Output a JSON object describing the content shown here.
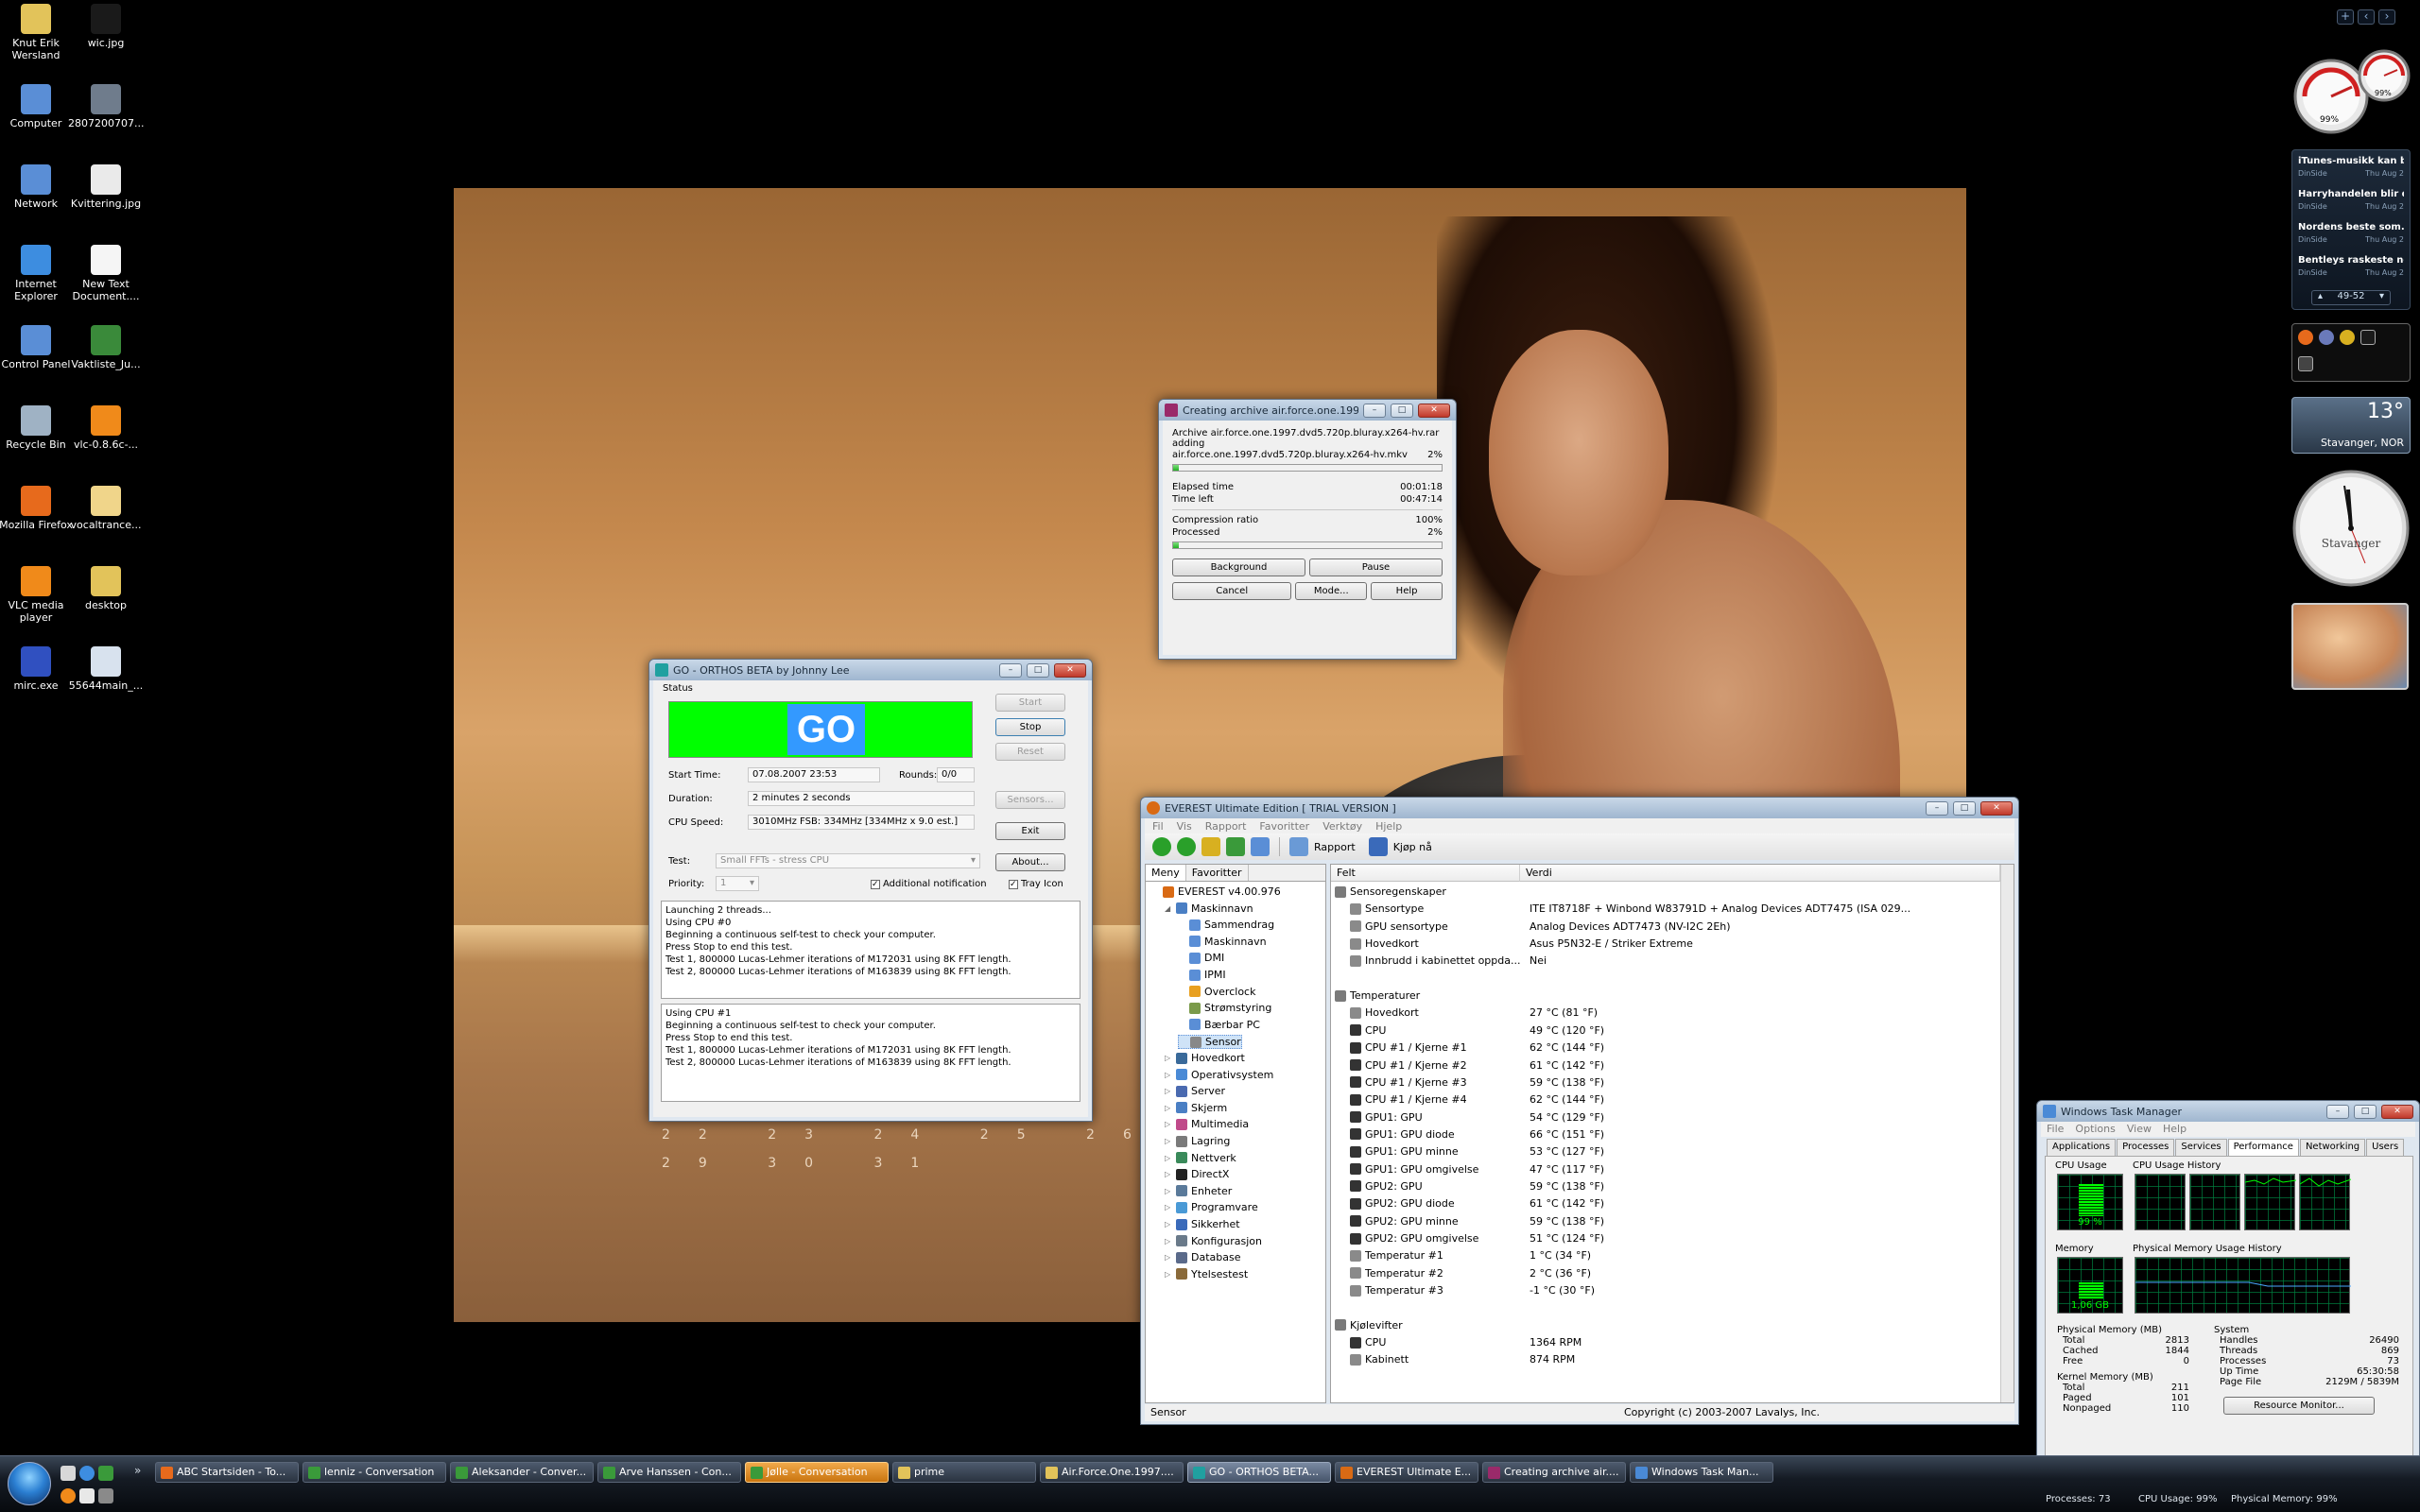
{
  "desktop_icons": [
    {
      "label": "Knut Erik Wersland",
      "icon": "folder-icon",
      "color": "#e2c35a"
    },
    {
      "label": "wic.jpg",
      "icon": "image-file-icon",
      "color": "#1a1a1a"
    },
    {
      "label": "Computer",
      "icon": "computer-icon",
      "color": "#5a8ed6"
    },
    {
      "label": "2807200707...",
      "icon": "image-file-icon",
      "color": "#6f7c8c"
    },
    {
      "label": "Network",
      "icon": "network-icon",
      "color": "#5a8ed6"
    },
    {
      "label": "Kvittering.jpg",
      "icon": "image-file-icon",
      "color": "#eaeaea"
    },
    {
      "label": "Internet Explorer",
      "icon": "internet-explorer-icon",
      "color": "#3d8de0"
    },
    {
      "label": "New Text Document....",
      "icon": "text-file-icon",
      "color": "#f5f5f5"
    },
    {
      "label": "Control Panel",
      "icon": "control-panel-icon",
      "color": "#5a8ed6"
    },
    {
      "label": "Vaktliste_Ju...",
      "icon": "excel-file-icon",
      "color": "#3a8a3a"
    },
    {
      "label": "Recycle Bin",
      "icon": "recycle-bin-icon",
      "color": "#9fb2c4"
    },
    {
      "label": "vlc-0.8.6c-...",
      "icon": "vlc-icon",
      "color": "#f08a1a"
    },
    {
      "label": "Mozilla Firefox",
      "icon": "firefox-icon",
      "color": "#e76a1c"
    },
    {
      "label": "vocaltrance...",
      "icon": "audio-file-icon",
      "color": "#f0d58a"
    },
    {
      "label": "VLC media player",
      "icon": "vlc-icon",
      "color": "#f08a1a"
    },
    {
      "label": "desktop",
      "icon": "folder-icon",
      "color": "#e2c35a"
    },
    {
      "label": "mirc.exe",
      "icon": "mirc-icon",
      "color": "#3050c0"
    },
    {
      "label": "55644main_...",
      "icon": "document-file-icon",
      "color": "#d8e2ee"
    }
  ],
  "wallpaper": {
    "calendar_row1": "22 23 24 25 26 27 28",
    "calendar_row2": "29 30 31"
  },
  "winrar": {
    "title": "Creating archive air.force.one.199...",
    "archive_line": "Archive air.force.one.1997.dvd5.720p.bluray.x264-hv.rar",
    "adding_label": "adding",
    "file_line": "air.force.one.1997.dvd5.720p.bluray.x264-hv.mkv",
    "file_percent": "2%",
    "file_progress": 0.02,
    "elapsed_label": "Elapsed time",
    "elapsed_value": "00:01:18",
    "timeleft_label": "Time left",
    "timeleft_value": "00:47:14",
    "ratio_label": "Compression ratio",
    "ratio_value": "100%",
    "processed_label": "Processed",
    "processed_value": "2%",
    "processed_progress": 0.02,
    "buttons": {
      "background": "Background",
      "pause": "Pause",
      "cancel": "Cancel",
      "mode": "Mode...",
      "help": "Help"
    }
  },
  "orthos": {
    "title": "GO - ORTHOS BETA by Johnny Lee",
    "status_label": "Status",
    "go_text": "GO",
    "start_time_label": "Start Time:",
    "start_time": "07.08.2007 23:53",
    "rounds_label": "Rounds:",
    "rounds": "0/0",
    "duration_label": "Duration:",
    "duration": "2 minutes 2 seconds",
    "cpu_speed_label": "CPU Speed:",
    "cpu_speed": "3010MHz FSB: 334MHz [334MHz x 9.0 est.]",
    "test_label": "Test:",
    "test_value": "Small FFTs - stress CPU",
    "priority_label": "Priority:",
    "priority_value": "1",
    "additional_notification": "Additional notification",
    "tray_icon": "Tray Icon",
    "buttons": {
      "start": "Start",
      "stop": "Stop",
      "reset": "Reset",
      "sensors": "Sensors...",
      "exit": "Exit",
      "about": "About..."
    },
    "log1": [
      "Launching 2 threads...",
      "Using CPU #0",
      "Beginning a continuous self-test to check your computer.",
      "Press Stop to end this test.",
      "Test 1, 800000 Lucas-Lehmer iterations of M172031 using 8K FFT length.",
      "Test 2, 800000 Lucas-Lehmer iterations of M163839 using 8K FFT length."
    ],
    "log2": [
      "Using CPU #1",
      "Beginning a continuous self-test to check your computer.",
      "Press Stop to end this test.",
      "Test 1, 800000 Lucas-Lehmer iterations of M172031 using 8K FFT length.",
      "Test 2, 800000 Lucas-Lehmer iterations of M163839 using 8K FFT length."
    ]
  },
  "everest": {
    "title": "EVEREST Ultimate Edition  [ TRIAL VERSION ]",
    "menu": [
      "Fil",
      "Vis",
      "Rapport",
      "Favoritter",
      "Verktøy",
      "Hjelp"
    ],
    "toolbar_report": "Rapport",
    "toolbar_buy": "Kjøp nå",
    "tabs": [
      "Meny",
      "Favoritter"
    ],
    "col_field": "Felt",
    "col_value": "Verdi",
    "tree": [
      {
        "label": "EVEREST v4.00.976",
        "level": 0,
        "icon": "everest-icon",
        "color": "#d96a14"
      },
      {
        "label": "Maskinnavn",
        "level": 1,
        "icon": "computer-icon",
        "color": "#4a7fc4"
      },
      {
        "label": "Sammendrag",
        "level": 2,
        "icon": "summary-icon",
        "color": "#5a8ed6"
      },
      {
        "label": "Maskinnavn",
        "level": 2,
        "icon": "computer-icon",
        "color": "#5a8ed6"
      },
      {
        "label": "DMI",
        "level": 2,
        "icon": "dmi-icon",
        "color": "#5a8ed6"
      },
      {
        "label": "IPMI",
        "level": 2,
        "icon": "ipmi-icon",
        "color": "#5a8ed6"
      },
      {
        "label": "Overclock",
        "level": 2,
        "icon": "overclock-icon",
        "color": "#e8a020"
      },
      {
        "label": "Strømstyring",
        "level": 2,
        "icon": "power-icon",
        "color": "#7a9a4a"
      },
      {
        "label": "Bærbar PC",
        "level": 2,
        "icon": "laptop-icon",
        "color": "#5a8ed6"
      },
      {
        "label": "Sensor",
        "level": 2,
        "icon": "sensor-icon",
        "color": "#888888"
      },
      {
        "label": "Hovedkort",
        "level": 1,
        "icon": "motherboard-icon",
        "color": "#3a6a9a"
      },
      {
        "label": "Operativsystem",
        "level": 1,
        "icon": "os-icon",
        "color": "#4a8ad6"
      },
      {
        "label": "Server",
        "level": 1,
        "icon": "server-icon",
        "color": "#4a6ab0"
      },
      {
        "label": "Skjerm",
        "level": 1,
        "icon": "monitor-icon",
        "color": "#4a7fc4"
      },
      {
        "label": "Multimedia",
        "level": 1,
        "icon": "multimedia-icon",
        "color": "#c04a8a"
      },
      {
        "label": "Lagring",
        "level": 1,
        "icon": "storage-icon",
        "color": "#7a7a7a"
      },
      {
        "label": "Nettverk",
        "level": 1,
        "icon": "network-icon",
        "color": "#3a8a5a"
      },
      {
        "label": "DirectX",
        "level": 1,
        "icon": "directx-icon",
        "color": "#222222"
      },
      {
        "label": "Enheter",
        "level": 1,
        "icon": "devices-icon",
        "color": "#5a7a9a"
      },
      {
        "label": "Programvare",
        "level": 1,
        "icon": "software-icon",
        "color": "#4a9ad6"
      },
      {
        "label": "Sikkerhet",
        "level": 1,
        "icon": "security-icon",
        "color": "#3a6aba"
      },
      {
        "label": "Konfigurasjon",
        "level": 1,
        "icon": "config-icon",
        "color": "#6a7a8a"
      },
      {
        "label": "Database",
        "level": 1,
        "icon": "database-icon",
        "color": "#5a6a8a"
      },
      {
        "label": "Ytelsestest",
        "level": 1,
        "icon": "benchmark-icon",
        "color": "#8a6a3a"
      }
    ],
    "rows": [
      {
        "field": "Sensoregenskaper",
        "value": "",
        "section": true,
        "icon": "sensor-icon"
      },
      {
        "field": "Sensortype",
        "value": "ITE IT8718F + Winbond W83791D + Analog Devices ADT7475  (ISA 029...",
        "icon": "sensor-icon"
      },
      {
        "field": "GPU sensortype",
        "value": "Analog Devices ADT7473  (NV-I2C 2Eh)",
        "icon": "sensor-icon"
      },
      {
        "field": "Hovedkort",
        "value": "Asus P5N32-E / Striker Extreme",
        "icon": "motherboard-icon"
      },
      {
        "field": "Innbrudd i kabinettet oppda...",
        "value": "Nei",
        "icon": "lock-icon"
      },
      {
        "field": "",
        "value": "",
        "spacer": true
      },
      {
        "field": "Temperaturer",
        "value": "",
        "section": true,
        "icon": "thermometer-icon"
      },
      {
        "field": "Hovedkort",
        "value": "27 °C  (81 °F)",
        "icon": "motherboard-icon"
      },
      {
        "field": "CPU",
        "value": "49 °C  (120 °F)",
        "icon": "chip-icon"
      },
      {
        "field": "CPU #1 / Kjerne #1",
        "value": "62 °C  (144 °F)",
        "icon": "chip-icon"
      },
      {
        "field": "CPU #1 / Kjerne #2",
        "value": "61 °C  (142 °F)",
        "icon": "chip-icon"
      },
      {
        "field": "CPU #1 / Kjerne #3",
        "value": "59 °C  (138 °F)",
        "icon": "chip-icon"
      },
      {
        "field": "CPU #1 / Kjerne #4",
        "value": "62 °C  (144 °F)",
        "icon": "chip-icon"
      },
      {
        "field": "GPU1: GPU",
        "value": "54 °C  (129 °F)",
        "icon": "chip-icon"
      },
      {
        "field": "GPU1: GPU diode",
        "value": "66 °C  (151 °F)",
        "icon": "chip-icon"
      },
      {
        "field": "GPU1: GPU minne",
        "value": "53 °C  (127 °F)",
        "icon": "chip-icon"
      },
      {
        "field": "GPU1: GPU omgivelse",
        "value": "47 °C  (117 °F)",
        "icon": "chip-icon"
      },
      {
        "field": "GPU2: GPU",
        "value": "59 °C  (138 °F)",
        "icon": "chip-icon"
      },
      {
        "field": "GPU2: GPU diode",
        "value": "61 °C  (142 °F)",
        "icon": "chip-icon"
      },
      {
        "field": "GPU2: GPU minne",
        "value": "59 °C  (138 °F)",
        "icon": "chip-icon"
      },
      {
        "field": "GPU2: GPU omgivelse",
        "value": "51 °C  (124 °F)",
        "icon": "chip-icon"
      },
      {
        "field": "Temperatur #1",
        "value": "1 °C  (34 °F)",
        "icon": "thermometer-icon"
      },
      {
        "field": "Temperatur #2",
        "value": "2 °C  (36 °F)",
        "icon": "thermometer-icon"
      },
      {
        "field": "Temperatur #3",
        "value": "-1 °C  (30 °F)",
        "icon": "thermometer-icon"
      },
      {
        "field": "",
        "value": "",
        "spacer": true
      },
      {
        "field": "Kjølevifter",
        "value": "",
        "section": true,
        "icon": "fan-icon"
      },
      {
        "field": "CPU",
        "value": "1364 RPM",
        "icon": "chip-icon"
      },
      {
        "field": "Kabinett",
        "value": "874 RPM",
        "icon": "case-icon"
      }
    ],
    "status_left": "Sensor",
    "status_right": "Copyright (c) 2003-2007 Lavalys, Inc."
  },
  "taskmgr": {
    "title": "Windows Task Manager",
    "menu": [
      "File",
      "Options",
      "View",
      "Help"
    ],
    "tabs": [
      "Applications",
      "Processes",
      "Services",
      "Performance",
      "Networking",
      "Users"
    ],
    "active_tab": "Performance",
    "cpu_usage_label": "CPU Usage",
    "cpu_usage_value": "99 %",
    "cpu_usage_fraction": 0.99,
    "cpu_history_label": "CPU Usage History",
    "memory_label": "Memory",
    "memory_value": "1,06 GB",
    "memory_fraction": 0.52,
    "mem_history_label": "Physical Memory Usage History",
    "physical_title": "Physical Memory (MB)",
    "physical": [
      [
        "Total",
        "2813"
      ],
      [
        "Cached",
        "1844"
      ],
      [
        "Free",
        "0"
      ]
    ],
    "kernel_title": "Kernel Memory (MB)",
    "kernel": [
      [
        "Total",
        "211"
      ],
      [
        "Paged",
        "101"
      ],
      [
        "Nonpaged",
        "110"
      ]
    ],
    "system_title": "System",
    "system": [
      [
        "Handles",
        "26490"
      ],
      [
        "Threads",
        "869"
      ],
      [
        "Processes",
        "73"
      ],
      [
        "Up Time",
        "65:30:58"
      ],
      [
        "Page File",
        "2129M / 5839M"
      ]
    ],
    "resource_monitor": "Resource Monitor..."
  },
  "taskbar": {
    "buttons": [
      {
        "label": "ABC Startsiden - To...",
        "icon": "firefox-icon",
        "color": "#e76a1c",
        "state": "normal"
      },
      {
        "label": "lenniz - Conversation",
        "icon": "msn-icon",
        "color": "#3a9a3a",
        "state": "normal"
      },
      {
        "label": "Aleksander - Conver...",
        "icon": "msn-icon",
        "color": "#3a9a3a",
        "state": "normal"
      },
      {
        "label": "Arve Hanssen - Con...",
        "icon": "msn-icon",
        "color": "#3a9a3a",
        "state": "normal"
      },
      {
        "label": "Jølle - Conversation",
        "icon": "msn-icon",
        "color": "#3a9a3a",
        "state": "flash"
      },
      {
        "label": "prime",
        "icon": "folder-icon",
        "color": "#e2c35a",
        "state": "normal"
      },
      {
        "label": "Air.Force.One.1997....",
        "icon": "folder-icon",
        "color": "#e2c35a",
        "state": "normal"
      },
      {
        "label": "GO - ORTHOS BETA...",
        "icon": "orthos-icon",
        "color": "#20a0a0",
        "state": "active"
      },
      {
        "label": "EVEREST Ultimate E...",
        "icon": "everest-icon",
        "color": "#d96a14",
        "state": "normal"
      },
      {
        "label": "Creating archive air....",
        "icon": "winrar-icon",
        "color": "#9a2a6a",
        "state": "normal"
      },
      {
        "label": "Windows Task Man...",
        "icon": "taskmgr-icon",
        "color": "#4a8ad6",
        "state": "normal"
      }
    ],
    "bottom_row": [
      "Processes: 73",
      "CPU Usage: 99%",
      "Physical Memory: 99%"
    ]
  },
  "sidebar": {
    "feed": [
      {
        "title": "iTunes-musikk kan b...",
        "source": "DinSide",
        "date": "Thu Aug 2"
      },
      {
        "title": "Harryhandelen blir d...",
        "source": "DinSide",
        "date": "Thu Aug 2"
      },
      {
        "title": "Nordens beste som...",
        "source": "DinSide",
        "date": "Thu Aug 2"
      },
      {
        "title": "Bentleys raskeste no...",
        "source": "DinSide",
        "date": "Thu Aug 2"
      }
    ],
    "feed_pager": "49-52",
    "weather_temp": "13°",
    "weather_city": "Stavanger, NOR",
    "clock_city": "Stavanger",
    "meter_cpu": "99%",
    "meter_mem": "99%"
  }
}
